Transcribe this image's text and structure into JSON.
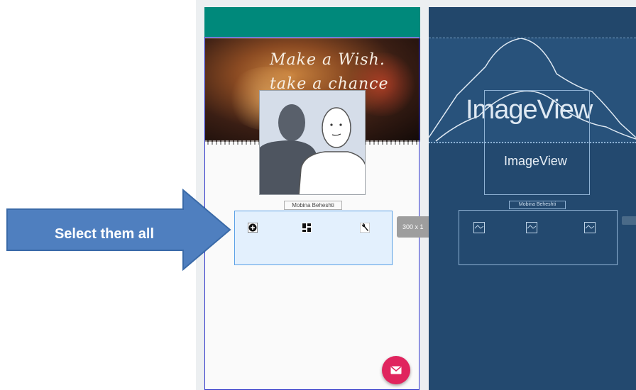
{
  "annotation": {
    "arrow_label": "Select them all"
  },
  "design": {
    "header_text_line1": "Make a Wish.",
    "header_text_line2": "take a chance",
    "name_label": "Mobina Beheshti",
    "size_tag": "300 x 1",
    "icons": [
      "add-circle-icon",
      "dashboard-icon",
      "wrench-icon"
    ],
    "fab_icon": "mail-icon"
  },
  "blueprint": {
    "header_label": "ImageView",
    "inner_label": "ImageView",
    "name_label": "Mobina Beheshti",
    "icons": [
      "image-placeholder-icon",
      "image-placeholder-icon",
      "image-placeholder-icon"
    ]
  },
  "colors": {
    "toolbar": "#00897b",
    "blueprint_bg": "#23496f",
    "selection": "#e3f0fd",
    "arrow": "#4f7fbf",
    "fab": "#e0245e"
  }
}
